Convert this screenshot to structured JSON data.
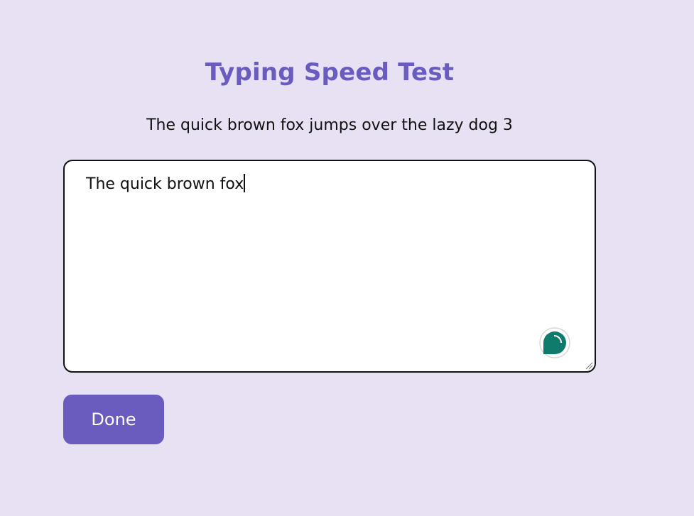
{
  "page": {
    "title": "Typing Speed Test",
    "prompt_text": "The quick brown fox jumps over the lazy dog 3"
  },
  "editor": {
    "value": "The quick brown fox",
    "badge_icon": "grammar-assistant-icon",
    "resize_icon": "resize-handle-icon"
  },
  "actions": {
    "done_label": "Done"
  },
  "colors": {
    "background": "#e8e1f3",
    "accent": "#6a5cbf",
    "badge": "#0f7b6c"
  }
}
